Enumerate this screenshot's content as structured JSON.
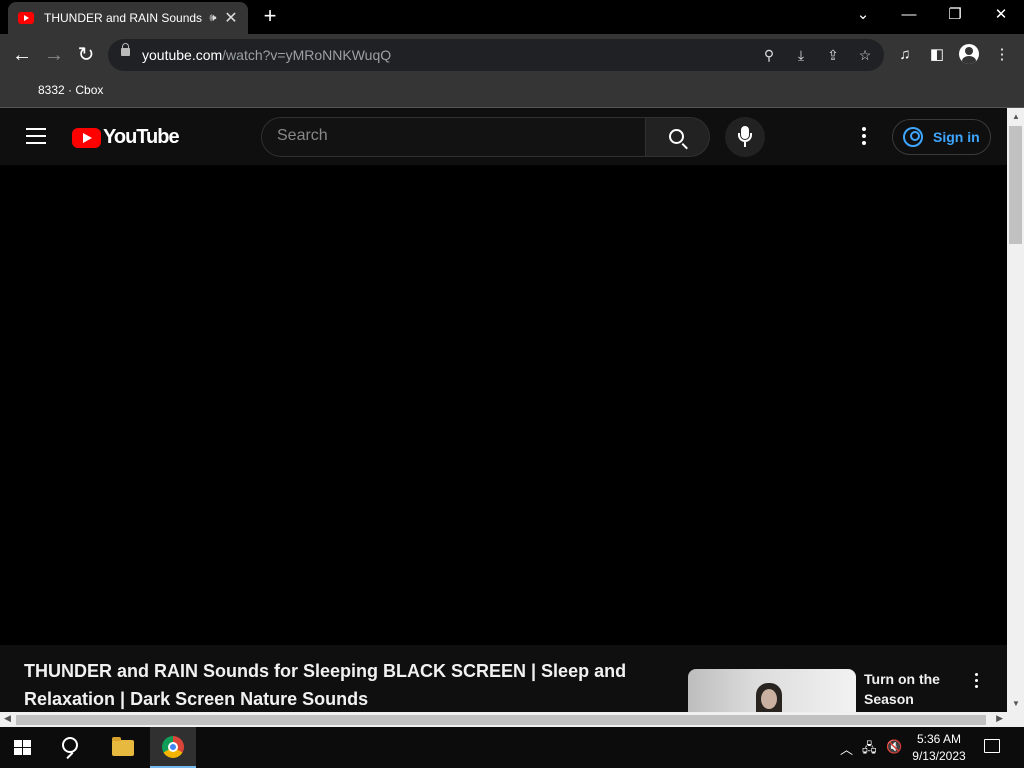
{
  "browser": {
    "tab": {
      "title": "THUNDER and RAIN Sounds for Sleeping BLACK SCREEN",
      "audio_icon": "speaker-icon",
      "close_icon": "close-icon"
    },
    "new_tab_icon": "plus-icon",
    "window_controls": {
      "tab_search": "chevron-down-icon",
      "minimize": "minimize-icon",
      "restore": "restore-icon",
      "close": "close-icon"
    },
    "url": {
      "domain": "youtube.com",
      "path": "/watch?v=yMRoNNKWuqQ"
    },
    "bookmark": "8332 · Cbox"
  },
  "youtube": {
    "logo_text": "YouTube",
    "search_placeholder": "Search",
    "sign_in_label": "Sign in",
    "video_title": "THUNDER and RAIN Sounds for Sleeping BLACK SCREEN | Sleep and Relaxation | Dark Screen Nature Sounds",
    "recommendation": {
      "title": "Turn on the Season"
    }
  },
  "taskbar": {
    "time": "5:36 AM",
    "date": "9/13/2023"
  },
  "colors": {
    "youtube_red": "#ff0000",
    "accent_blue": "#3ea6ff",
    "header_bg": "#0f0f0f",
    "browser_toolbar": "#353535"
  }
}
